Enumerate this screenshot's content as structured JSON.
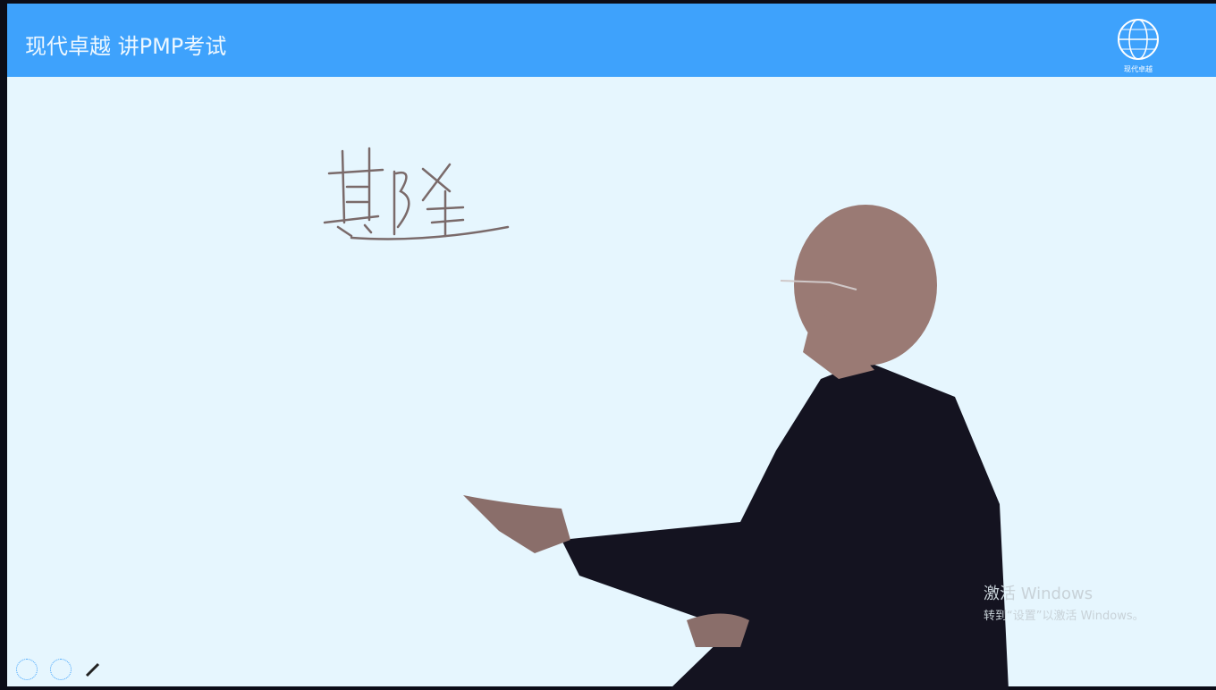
{
  "header": {
    "title": "现代卓越 讲PMP考试",
    "logo_text": "现代卓越"
  },
  "board": {
    "handwriting": "斯隆"
  },
  "watermark": {
    "line1": "激活 Windows",
    "line2": "转到“设置”以激活 Windows。"
  },
  "controls": {
    "icons": [
      "prev-icon",
      "next-icon",
      "pen-icon"
    ]
  },
  "colors": {
    "header": "#3ea2fc",
    "background": "#e6f6fe",
    "frame": "#0b0d18"
  }
}
